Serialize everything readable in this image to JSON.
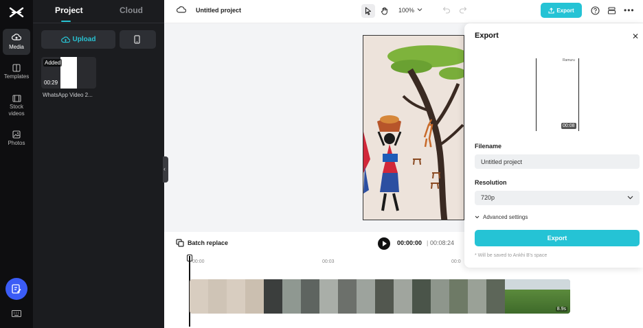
{
  "rail": {
    "items": [
      {
        "label": "Media",
        "icon": "media-icon"
      },
      {
        "label": "Templates",
        "icon": "templates-icon"
      },
      {
        "label": "Stock videos",
        "icon": "film-icon"
      },
      {
        "label": "Photos",
        "icon": "image-icon"
      }
    ]
  },
  "panel": {
    "tabs": [
      "Project",
      "Cloud"
    ],
    "upload_label": "Upload",
    "media": [
      {
        "badge": "Added",
        "duration": "00:29",
        "name": "WhatsApp Video 2..."
      }
    ]
  },
  "topbar": {
    "project_title": "Untitled project",
    "zoom": "100%",
    "export_label": "Export"
  },
  "timeline": {
    "batch_label": "Batch replace",
    "current_time": "00:00:00",
    "separator": "|",
    "total_time": "00:08:24",
    "ruler": [
      "00:00",
      "00:03",
      "00:0"
    ],
    "track_duration": "8.9s"
  },
  "export_panel": {
    "title": "Export",
    "preview_duration": "00:08",
    "preview_caption": "Ramuru",
    "filename_label": "Filename",
    "filename_value": "Untitled project",
    "resolution_label": "Resolution",
    "resolution_value": "720p",
    "advanced_label": "Advanced settings",
    "export_button": "Export",
    "note": "* Will be saved to Ankhi B's space"
  },
  "colors": {
    "accent": "#25c3d5",
    "rail_bg": "#0e0e10",
    "panel_bg": "#1b1c1f",
    "fab": "#3b5cf6"
  }
}
